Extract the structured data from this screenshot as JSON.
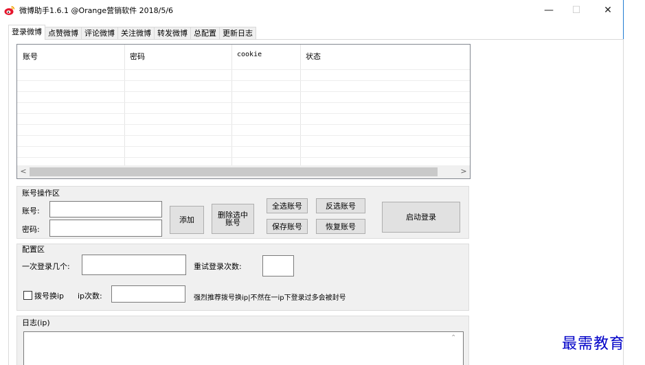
{
  "window": {
    "title": "微博助手1.6.1 @Orange营销软件 2018/5/6",
    "minimize_glyph": "—",
    "maximize_glyph": "☐",
    "close_glyph": "✕",
    "app_icon": "weibo-logo-icon",
    "accent_color": "#1f7ad1"
  },
  "tabs": [
    {
      "label": "登录微博",
      "active": true
    },
    {
      "label": "点赞微博",
      "active": false
    },
    {
      "label": "评论微博",
      "active": false
    },
    {
      "label": "关注微博",
      "active": false
    },
    {
      "label": "转发微博",
      "active": false
    },
    {
      "label": "总配置",
      "active": false
    },
    {
      "label": "更新日志",
      "active": false
    }
  ],
  "account_table": {
    "columns": [
      "账号",
      "密码",
      "cookie",
      "状态"
    ],
    "rows": [],
    "scroll_left_glyph": "<",
    "scroll_right_glyph": ">"
  },
  "account_ops": {
    "title": "账号操作区",
    "account_label": "账号:",
    "password_label": "密码:",
    "account_value": "",
    "password_value": "",
    "add_button": "添加",
    "delete_selected_button": "删除选中账号",
    "select_all_button": "全选账号",
    "invert_select_button": "反选账号",
    "save_accounts_button": "保存账号",
    "restore_accounts_button": "恢复账号",
    "start_login_button": "启动登录"
  },
  "config": {
    "title": "配置区",
    "per_login_label": "一次登录几个:",
    "per_login_value": "",
    "retry_label": "重试登录次数:",
    "retry_value": "",
    "dial_checkbox_label": "拨号换ip",
    "dial_checked": false,
    "ip_count_label": "ip次数:",
    "ip_count_value": "",
    "hint": "强烈推荐拨号换ip|不然在一ip下登录过多会被封号"
  },
  "log": {
    "title": "日志(ip)",
    "content": "",
    "scroll_up_glyph": "⌃"
  },
  "watermark": "最需教育"
}
